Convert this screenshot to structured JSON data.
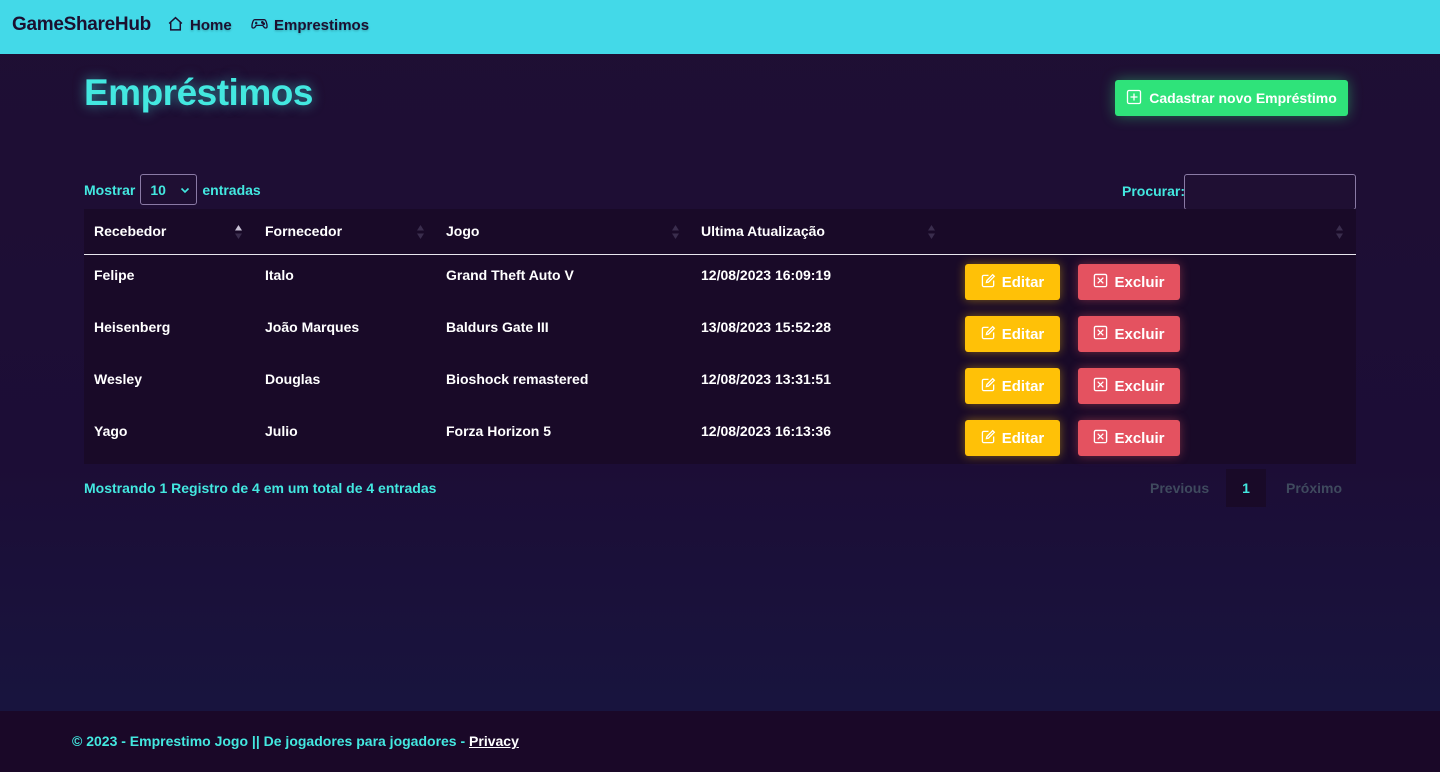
{
  "navbar": {
    "brand": "GameShareHub",
    "links": [
      {
        "label": "Home",
        "icon": "home-icon"
      },
      {
        "label": "Emprestimos",
        "icon": "gamepad-icon"
      }
    ]
  },
  "page": {
    "title": "Empréstimos",
    "add_button": "Cadastrar novo Empréstimo"
  },
  "table_controls": {
    "show_label": "Mostrar",
    "page_size": "10",
    "entries_label": "entradas",
    "search_label": "Procurar:",
    "search_value": ""
  },
  "table": {
    "columns": [
      "Recebedor",
      "Fornecedor",
      "Jogo",
      "Ultima Atualização",
      ""
    ],
    "rows": [
      {
        "recebedor": "Felipe",
        "fornecedor": "Italo",
        "jogo": "Grand Theft Auto V",
        "atualizacao": "12/08/2023 16:09:19"
      },
      {
        "recebedor": "Heisenberg",
        "fornecedor": "João Marques",
        "jogo": "Baldurs Gate III",
        "atualizacao": "13/08/2023 15:52:28"
      },
      {
        "recebedor": "Wesley",
        "fornecedor": "Douglas",
        "jogo": "Bioshock remastered",
        "atualizacao": "12/08/2023 13:31:51"
      },
      {
        "recebedor": "Yago",
        "fornecedor": "Julio",
        "jogo": "Forza Horizon 5",
        "atualizacao": "12/08/2023 16:13:36"
      }
    ],
    "edit_label": "Editar",
    "delete_label": "Excluir"
  },
  "info": "Mostrando 1 Registro de 4 em um total de 4 entradas",
  "pagination": {
    "previous": "Previous",
    "current": "1",
    "next": "Próximo"
  },
  "footer": {
    "text": "© 2023 - Emprestimo Jogo || De jogadores para jogadores - ",
    "link": "Privacy"
  },
  "colors": {
    "navbar": "#43d9e8",
    "accent": "#43e8e0",
    "success": "#2fe37a",
    "warning": "#ffc107",
    "danger": "#e45260",
    "background": "#1f0f33"
  }
}
